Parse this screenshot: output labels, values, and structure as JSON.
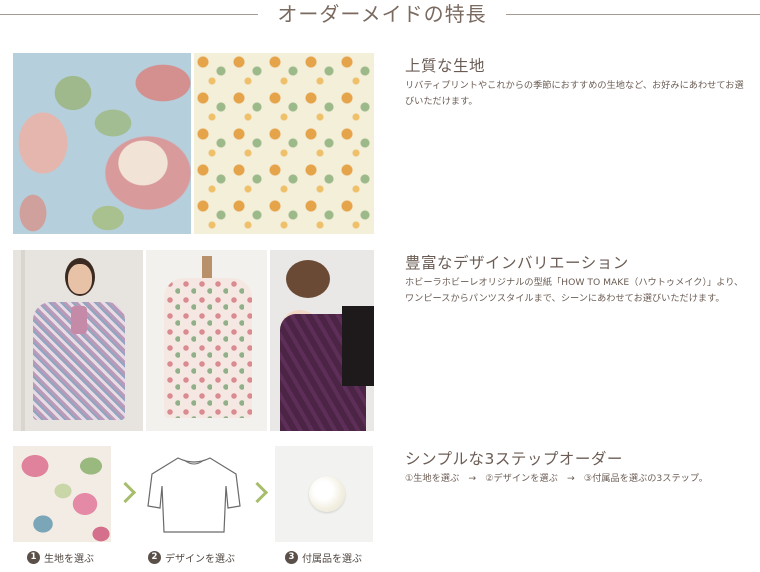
{
  "header": {
    "title": "オーダーメイドの特長"
  },
  "features": [
    {
      "title": "上質な生地",
      "description": "リバティプリントやこれからの季節におすすめの生地など、お好みにあわせてお選びいただけます。"
    },
    {
      "title": "豊富なデザインバリエーション",
      "description": "ホビーラホビーレオリジナルの型紙「HOW TO MAKE（ハウトゥメイク）」より、ワンピースからパンツスタイルまで、シーンにあわせてお選びいただけます。"
    },
    {
      "title": "シンプルな3ステップオーダー",
      "description": "①生地を選ぶ　→　②デザインを選ぶ　→　③付属品を選ぶの3ステップ。"
    }
  ],
  "steps": [
    {
      "number": "1",
      "label": "生地を選ぶ"
    },
    {
      "number": "2",
      "label": "デザインを選ぶ"
    },
    {
      "number": "3",
      "label": "付属品を選ぶ"
    }
  ],
  "colors": {
    "accent_green": "#a7bd6b",
    "text_brown": "#6b5d55",
    "rule": "#a79a92"
  }
}
